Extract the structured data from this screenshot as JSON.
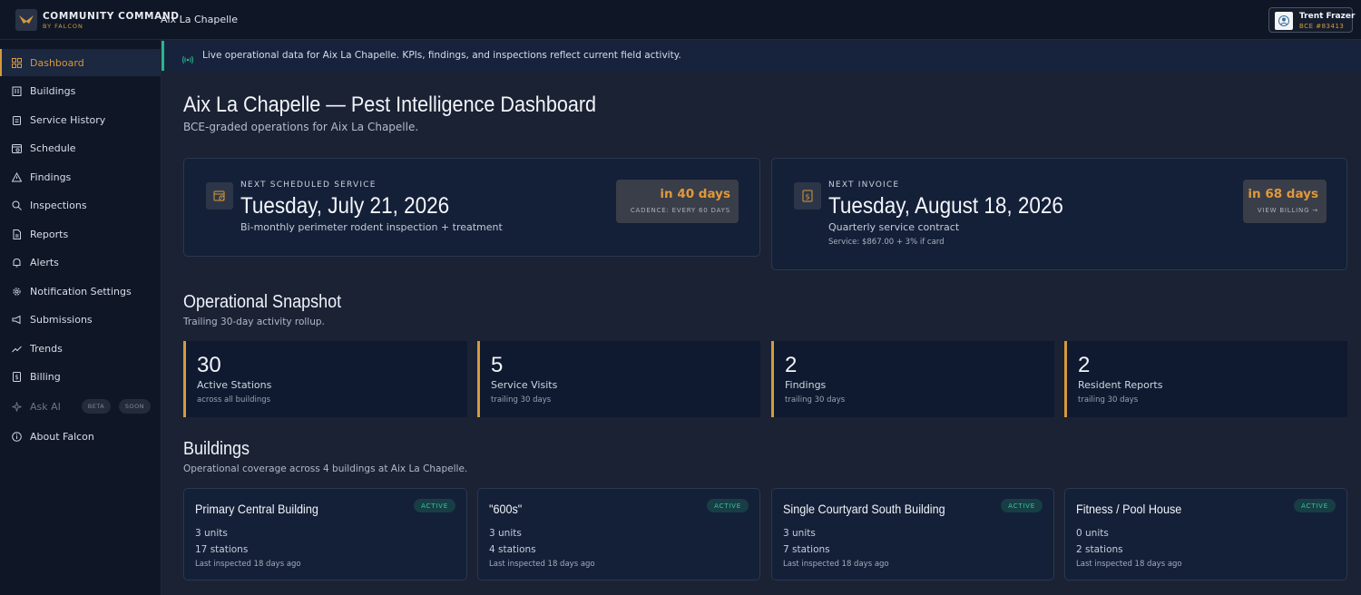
{
  "header": {
    "brand_title": "COMMUNITY COMMAND",
    "brand_subtitle": "BY FALCON",
    "location": "Aix La Chapelle",
    "user_name": "Trent Frazer",
    "user_id": "BCE #83413"
  },
  "sidebar": {
    "items": [
      {
        "label": "Dashboard",
        "icon": "dashboard-icon",
        "active": true
      },
      {
        "label": "Buildings",
        "icon": "building-icon"
      },
      {
        "label": "Service History",
        "icon": "clipboard-icon"
      },
      {
        "label": "Schedule",
        "icon": "calendar-icon"
      },
      {
        "label": "Findings",
        "icon": "warning-icon"
      },
      {
        "label": "Inspections",
        "icon": "search-icon"
      },
      {
        "label": "Reports",
        "icon": "document-icon"
      },
      {
        "label": "Alerts",
        "icon": "bell-icon"
      },
      {
        "label": "Notification Settings",
        "icon": "gear-icon"
      },
      {
        "label": "Submissions",
        "icon": "megaphone-icon"
      },
      {
        "label": "Trends",
        "icon": "trend-icon"
      },
      {
        "label": "Billing",
        "icon": "billing-icon"
      }
    ],
    "ask_ai": {
      "label": "Ask AI",
      "badge_beta": "BETA",
      "badge_soon": "SOON"
    },
    "about": {
      "label": "About Falcon"
    }
  },
  "banner": {
    "text": "Live operational data for Aix La Chapelle. KPIs, findings, and inspections reflect current field activity.",
    "accent": "#2bb58a"
  },
  "page": {
    "title": "Aix La Chapelle — Pest Intelligence Dashboard",
    "subtitle": "BCE-graded operations for Aix La Chapelle."
  },
  "next_service": {
    "eyebrow": "NEXT SCHEDULED SERVICE",
    "date": "Tuesday, July 21, 2026",
    "description": "Bi-monthly perimeter rodent inspection + treatment",
    "due": "in 40 days",
    "due_sub": "CADENCE: EVERY 60 DAYS"
  },
  "next_invoice": {
    "eyebrow": "NEXT INVOICE",
    "date": "Tuesday, August 18, 2026",
    "description": "Quarterly service contract",
    "note": "Service: $867.00 + 3% if card",
    "due": "in 68 days",
    "due_sub": "VIEW BILLING →"
  },
  "snapshot": {
    "title": "Operational Snapshot",
    "subtitle": "Trailing 30-day activity rollup.",
    "kpis": [
      {
        "value": "30",
        "label": "Active Stations",
        "sub": "across all buildings"
      },
      {
        "value": "5",
        "label": "Service Visits",
        "sub": "trailing 30 days"
      },
      {
        "value": "2",
        "label": "Findings",
        "sub": "trailing 30 days"
      },
      {
        "value": "2",
        "label": "Resident Reports",
        "sub": "trailing 30 days"
      }
    ]
  },
  "buildings": {
    "title": "Buildings",
    "subtitle": "Operational coverage across 4 buildings at Aix La Chapelle.",
    "items": [
      {
        "name": "Primary Central Building",
        "status": "ACTIVE",
        "units": "3 units",
        "stations": "17 stations",
        "inspected": "Last inspected 18 days ago"
      },
      {
        "name": "\"600s\"",
        "status": "ACTIVE",
        "units": "3 units",
        "stations": "4 stations",
        "inspected": "Last inspected 18 days ago"
      },
      {
        "name": "Single Courtyard South Building",
        "status": "ACTIVE",
        "units": "3 units",
        "stations": "7 stations",
        "inspected": "Last inspected 18 days ago"
      },
      {
        "name": "Fitness / Pool House",
        "status": "ACTIVE",
        "units": "0 units",
        "stations": "2 stations",
        "inspected": "Last inspected 18 days ago"
      }
    ]
  },
  "colors": {
    "accent": "#d59a3b",
    "active_status": "#3cc39b",
    "background": "#1a2234"
  }
}
